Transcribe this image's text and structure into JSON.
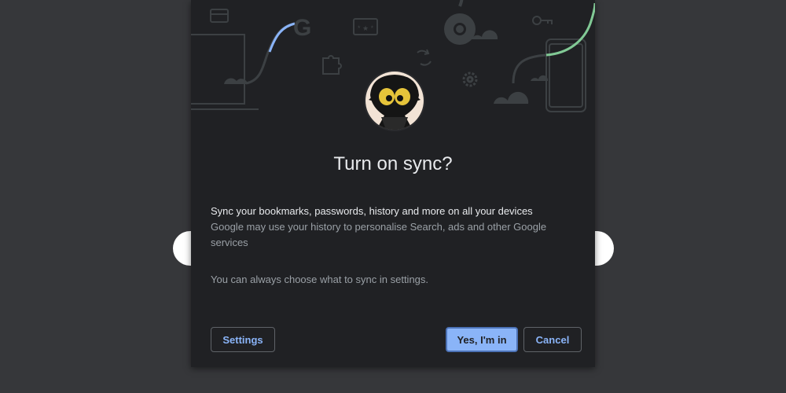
{
  "dialog": {
    "title": "Turn on sync?",
    "headline": "Sync your bookmarks, passwords, history and more on all your devices",
    "description": "Google may use your history to personalise Search, ads and other Google services",
    "note": "You can always choose what to sync in settings."
  },
  "buttons": {
    "settings_label": "Settings",
    "confirm_label": "Yes, I'm in",
    "cancel_label": "Cancel"
  },
  "colors": {
    "background": "#36373a",
    "dialog": "#202124",
    "accent": "#8ab4f8",
    "illustration_blue": "#8ab4f8",
    "illustration_green": "#81c995"
  },
  "icons": [
    "card-icon",
    "google-logo-icon",
    "puzzle-icon",
    "password-card-icon",
    "sync-icon",
    "chrome-logo-icon",
    "settings-gear-icon",
    "key-icon",
    "laptop-icon",
    "phone-icon",
    "cloud-icon"
  ]
}
